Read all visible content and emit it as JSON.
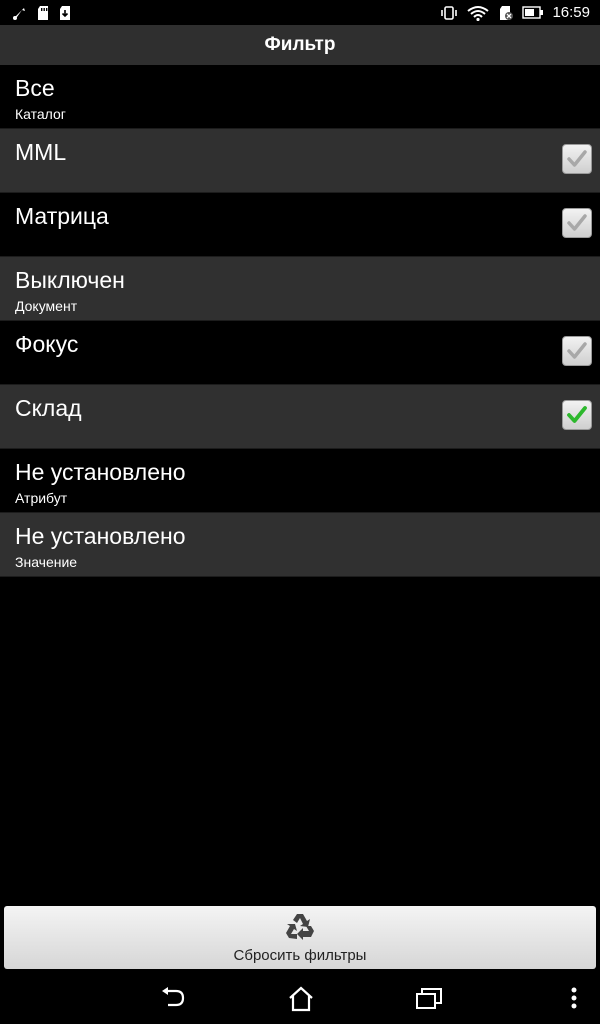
{
  "status_bar": {
    "time": "16:59",
    "left_icons": [
      "usb-icon",
      "sd-card-icon",
      "download-icon"
    ],
    "right_icons": [
      "vibrate-icon",
      "wifi-icon",
      "sim-icon",
      "battery-icon"
    ]
  },
  "header": {
    "title": "Фильтр"
  },
  "filters": [
    {
      "title": "Все",
      "subtitle": "Каталог",
      "checkbox": null
    },
    {
      "title": "MML",
      "subtitle": "",
      "checkbox": "disabled-checked"
    },
    {
      "title": "Матрица",
      "subtitle": "",
      "checkbox": "disabled-checked"
    },
    {
      "title": "Выключен",
      "subtitle": "Документ",
      "checkbox": null
    },
    {
      "title": "Фокус",
      "subtitle": "",
      "checkbox": "disabled-checked"
    },
    {
      "title": "Склад",
      "subtitle": "",
      "checkbox": "checked"
    },
    {
      "title": "Не установлено",
      "subtitle": "Атрибут",
      "checkbox": null
    },
    {
      "title": "Не установлено",
      "subtitle": "Значение",
      "checkbox": null
    }
  ],
  "reset_button": {
    "label": "Сбросить фильтры",
    "icon": "recycle-icon"
  },
  "nav_bar": {
    "icons": [
      "back-icon",
      "home-icon",
      "recents-icon",
      "menu-icon"
    ]
  },
  "colors": {
    "check_active": "#2db82d",
    "check_disabled": "#a8a8a8",
    "row_alt": "#303030"
  }
}
